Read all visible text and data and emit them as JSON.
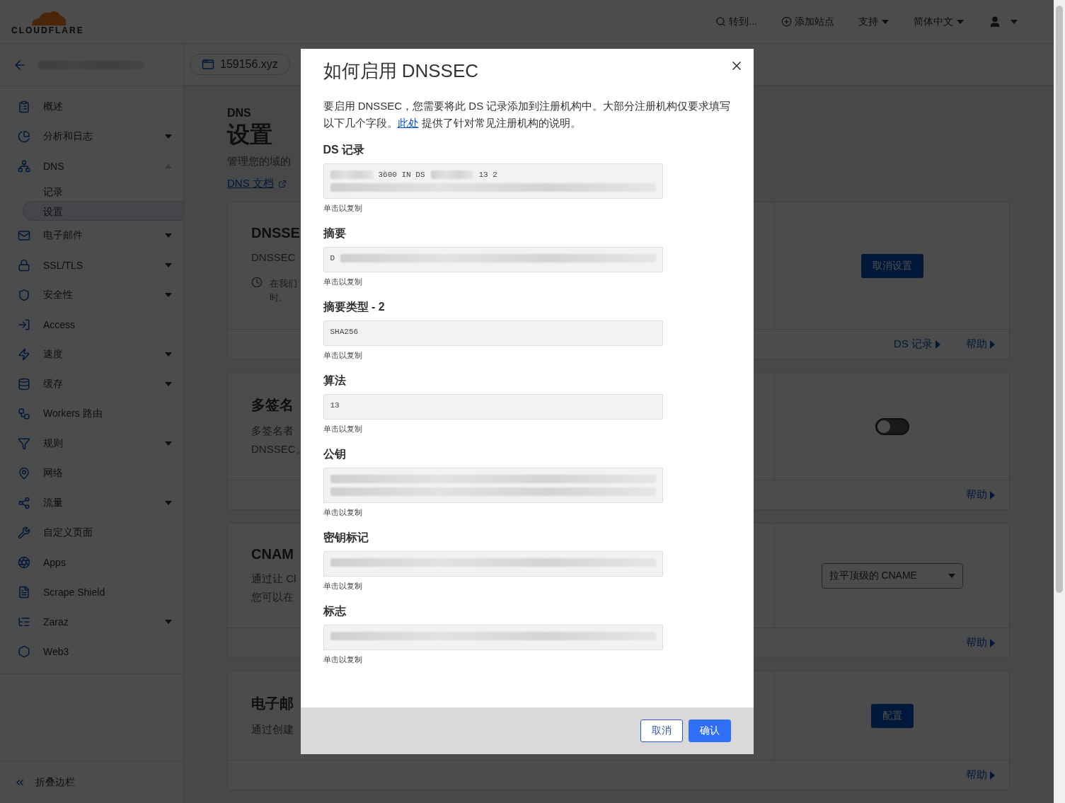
{
  "header": {
    "logo": "CLOUDFLARE",
    "goto": "转到...",
    "add_site": "添加站点",
    "support": "支持",
    "language": "简体中文"
  },
  "sidebar": {
    "items": [
      {
        "label": "概述",
        "has_menu": false,
        "selected": false
      },
      {
        "label": "分析和日志",
        "has_menu": true,
        "selected": false
      },
      {
        "label": "DNS",
        "has_menu": true,
        "expanded": true,
        "selected": false,
        "children": [
          {
            "label": "记录",
            "selected": false
          },
          {
            "label": "设置",
            "selected": true
          }
        ]
      },
      {
        "label": "电子邮件",
        "has_menu": true,
        "selected": false
      },
      {
        "label": "SSL/TLS",
        "has_menu": true,
        "selected": false
      },
      {
        "label": "安全性",
        "has_menu": true,
        "selected": false
      },
      {
        "label": "Access",
        "has_menu": false,
        "selected": false
      },
      {
        "label": "速度",
        "has_menu": true,
        "selected": false
      },
      {
        "label": "缓存",
        "has_menu": true,
        "selected": false
      },
      {
        "label": "Workers 路由",
        "has_menu": false,
        "selected": false
      },
      {
        "label": "规则",
        "has_menu": true,
        "selected": false
      },
      {
        "label": "网络",
        "has_menu": false,
        "selected": false
      },
      {
        "label": "流量",
        "has_menu": true,
        "selected": false
      },
      {
        "label": "自定义页面",
        "has_menu": false,
        "selected": false
      },
      {
        "label": "Apps",
        "has_menu": false,
        "selected": false
      },
      {
        "label": "Scrape Shield",
        "has_menu": false,
        "selected": false
      },
      {
        "label": "Zaraz",
        "has_menu": true,
        "selected": false
      },
      {
        "label": "Web3",
        "has_menu": false,
        "selected": false
      }
    ],
    "collapse": "折叠边栏"
  },
  "main": {
    "domain": "159156.xyz",
    "section": "DNS",
    "title": "设置",
    "subtitle": "管理您的域的",
    "docs_link": "DNS 文档",
    "cards": [
      {
        "title": "DNSSE",
        "lines": [
          "DNSSEC"
        ],
        "note": [
          "在我们",
          "时。"
        ],
        "control": {
          "kind": "button",
          "label": "取消设置"
        },
        "links": [
          "DS 记录",
          "帮助"
        ]
      },
      {
        "title": "多签名",
        "lines": [
          "多签名者",
          "DNSSEC。"
        ],
        "control": {
          "kind": "toggle",
          "on": false
        },
        "links": [
          "帮助"
        ]
      },
      {
        "title": "CNAM",
        "lines": [
          "通过让 Cl",
          "您可以在"
        ],
        "control": {
          "kind": "select",
          "value": "拉平顶级的 CNAME"
        },
        "links": [
          "帮助"
        ]
      },
      {
        "title": "电子邮",
        "lines": [
          "通过创建"
        ],
        "control": {
          "kind": "button",
          "label": "配置"
        },
        "links": [
          "帮助"
        ]
      }
    ]
  },
  "dialog": {
    "title": "如何启用 DNSSEC",
    "intro_before": "要启用 DNSSEC，您需要将此 DS 记录添加到注册机构中。大部分注册机构仅要求填写以下几个字段。",
    "intro_link": "此处",
    "intro_after": "提供了针对常见注册机构的说明。",
    "fields": [
      {
        "label": "DS 记录",
        "hint": "单击以复制",
        "lines": [
          [
            {
              "kind": "blur"
            },
            {
              "kind": "text",
              "text": "3600 IN DS"
            },
            {
              "kind": "blur"
            },
            {
              "kind": "text",
              "text": "13 2"
            }
          ],
          [
            {
              "kind": "blur"
            }
          ]
        ]
      },
      {
        "label": "摘要",
        "hint": "单击以复制",
        "lines": [
          [
            {
              "kind": "text",
              "text": "D"
            },
            {
              "kind": "blur"
            }
          ]
        ]
      },
      {
        "label": "摘要类型 - 2",
        "hint": "单击以复制",
        "lines": [
          [
            {
              "kind": "text",
              "text": "SHA256"
            }
          ]
        ]
      },
      {
        "label": "算法",
        "hint": "单击以复制",
        "lines": [
          [
            {
              "kind": "text",
              "text": "13"
            }
          ]
        ]
      },
      {
        "label": "公钥",
        "hint": "单击以复制",
        "lines": [
          [
            {
              "kind": "blur"
            }
          ],
          [
            {
              "kind": "blur"
            }
          ]
        ]
      },
      {
        "label": "密钥标记",
        "hint": "单击以复制",
        "lines": [
          [
            {
              "kind": "blur"
            }
          ]
        ]
      },
      {
        "label": "标志",
        "hint": "单击以复制",
        "lines": [
          [
            {
              "kind": "blur"
            }
          ]
        ]
      }
    ],
    "buttons": [
      {
        "kind": "secondary",
        "label": "取消"
      },
      {
        "kind": "primary",
        "label": "确认"
      }
    ]
  }
}
